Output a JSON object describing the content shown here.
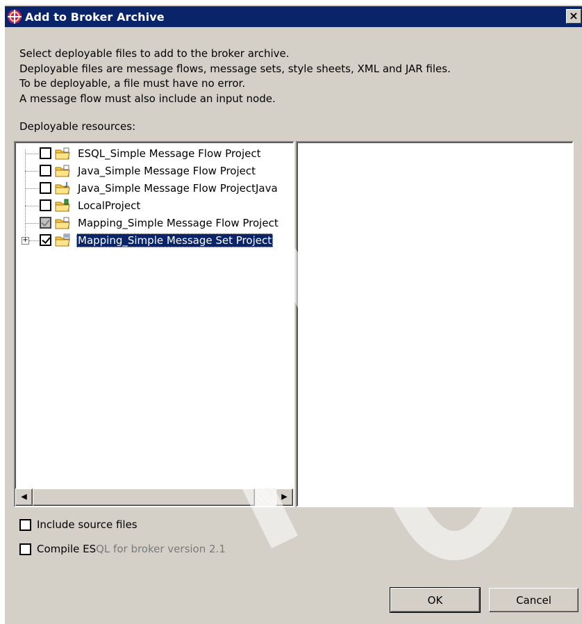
{
  "window": {
    "title": "Add to Broker Archive",
    "close_label": "×"
  },
  "description": [
    "Select deployable files to add to the broker archive.",
    "Deployable files are message flows, message sets, style sheets, XML and JAR files.",
    "To be deployable, a file must have no error.",
    "A message flow must also include an input node."
  ],
  "resources_label": "Deployable resources:",
  "tree": {
    "items": [
      {
        "label": "ESQL_Simple Message Flow Project",
        "state": "unchecked"
      },
      {
        "label": "Java_Simple Message Flow Project",
        "state": "unchecked"
      },
      {
        "label": "Java_Simple Message Flow ProjectJava",
        "state": "unchecked"
      },
      {
        "label": "LocalProject",
        "state": "unchecked"
      },
      {
        "label": "Mapping_Simple Message Flow Project",
        "state": "grayed"
      },
      {
        "label": "Mapping_Simple Message Set Project",
        "state": "checked",
        "selected": true,
        "expandable": true
      }
    ]
  },
  "scrollbar": {
    "left_arrow": "◀",
    "right_arrow": "▶"
  },
  "expander_symbol": "+",
  "options": {
    "include_source": {
      "label": "Include source files",
      "checked": false
    },
    "compile_esql": {
      "label_prefix": "Compile ES",
      "label_suffix": "QL for broker version 2.1",
      "checked": false
    }
  },
  "buttons": {
    "ok": "OK",
    "cancel": "Cancel"
  },
  "colors": {
    "dialog_bg": "#d4d0c8",
    "titlebar": "#0a246a",
    "selection": "#0a246a"
  }
}
